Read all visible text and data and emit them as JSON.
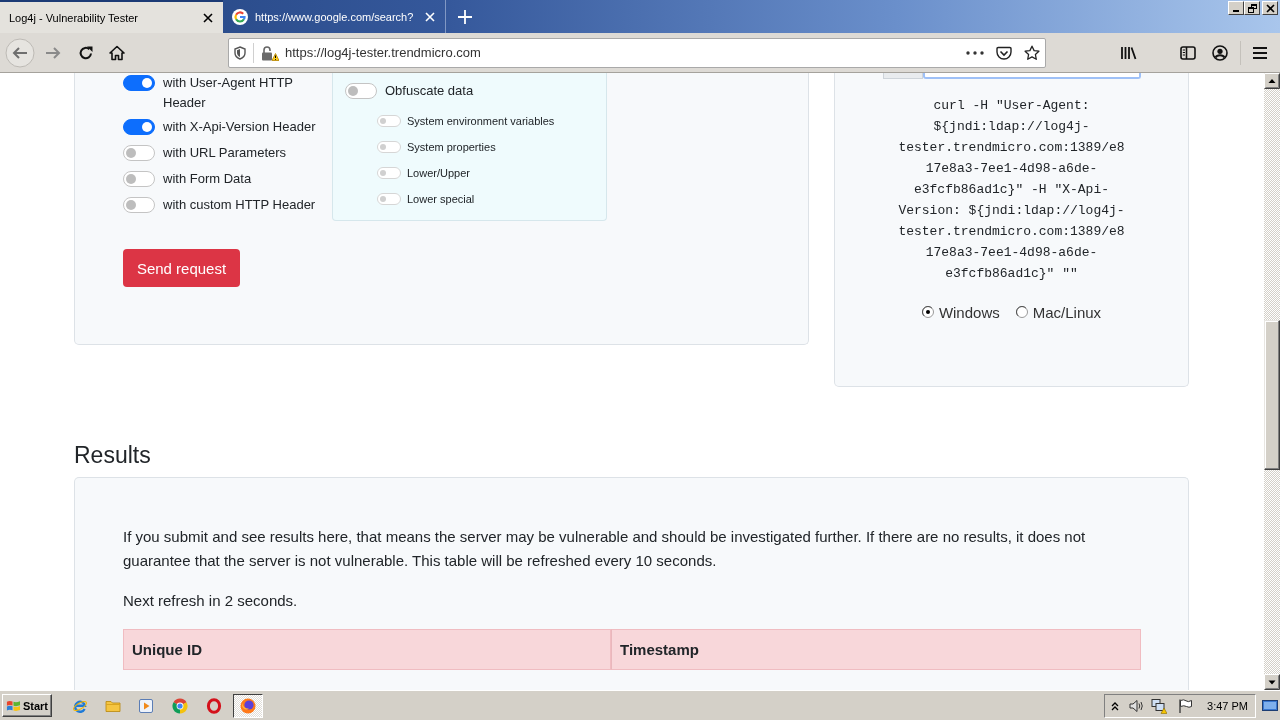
{
  "browser": {
    "tabs": [
      {
        "title": "Log4j - Vulnerability Tester",
        "selected": true,
        "favicon": false
      },
      {
        "title": "https://www.google.com/search?",
        "selected": false,
        "favicon": true
      }
    ],
    "url": "https://log4j-tester.trendmicro.com"
  },
  "request_form": {
    "options": [
      {
        "label": "with User-Agent HTTP Header",
        "on": true
      },
      {
        "label": "with X-Api-Version Header",
        "on": true
      },
      {
        "label": "with URL Parameters",
        "on": false
      },
      {
        "label": "with Form Data",
        "on": false
      },
      {
        "label": "with custom HTTP Header",
        "on": false
      }
    ],
    "obfuscation": {
      "label": "Obfuscate data",
      "on": false,
      "methods": [
        {
          "label": "System environment variables",
          "on": false
        },
        {
          "label": "System properties",
          "on": false
        },
        {
          "label": "Lower/Upper",
          "on": false
        },
        {
          "label": "Lower special",
          "on": false
        }
      ]
    },
    "submit_button": "Send request"
  },
  "command_panel": {
    "command": "curl -H \"User-Agent: ${jndi:ldap://log4j-tester.trendmicro.com:1389/e817e8a3-7ee1-4d98-a6de-e3fcfb86ad1c}\" -H \"X-Api-Version: ${jndi:ldap://log4j-tester.trendmicro.com:1389/e817e8a3-7ee1-4d98-a6de-e3fcfb86ad1c}\" \"\"",
    "platforms": [
      {
        "label": "Windows",
        "selected": true
      },
      {
        "label": "Mac/Linux",
        "selected": false
      }
    ]
  },
  "results": {
    "heading": "Results",
    "description": "If you submit and see results here, that means the server may be vulnerable and should be investigated further. If there are no results, it does not guarantee that the server is not vulnerable. This table will be refreshed every 10 seconds.",
    "refresh_note": "Next refresh in 2 seconds.",
    "table": {
      "columns": [
        "Unique ID",
        "Timestamp"
      ]
    }
  },
  "taskbar": {
    "start_button": "Start",
    "windows": [
      {
        "selected": true
      }
    ],
    "clock": "3:47 PM"
  }
}
